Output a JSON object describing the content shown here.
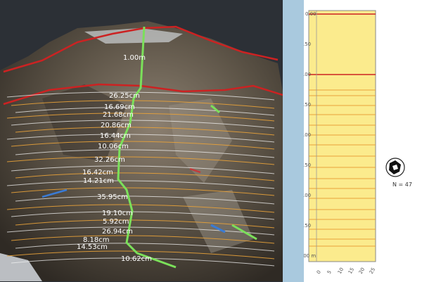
{
  "viewport": {
    "labels": [
      "1.00m",
      "26.25cm",
      "16.69cm",
      "21.68cm",
      "20.86cm",
      "16.44cm",
      "10.06cm",
      "32.26cm",
      "16.42cm",
      "14.21cm",
      "35.95cm",
      "19.10cm",
      "5.92cm",
      "26.94cm",
      "8.18cm",
      "14.53cm",
      "10.62cm"
    ]
  },
  "depth_log": {
    "depth_ticks": [
      "0.00",
      "-0.50",
      "-1.00",
      "-1.50",
      "-2.00",
      "-2.50",
      "-3.00",
      "-3.50",
      "-4.00 m"
    ],
    "bottom_ticks": [
      "0",
      "5",
      "10",
      "15",
      "20",
      "25"
    ],
    "stereonet_label": "N = 47",
    "colors": {
      "column_fill": "#fbeb8d",
      "layer_line": "#e8a23a",
      "boundary": "#cc2222"
    }
  }
}
